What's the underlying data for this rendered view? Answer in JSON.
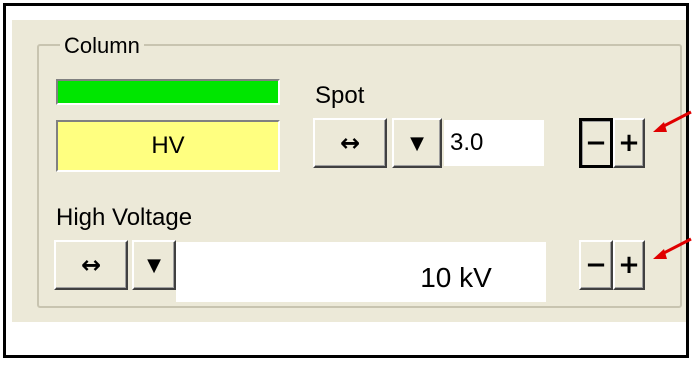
{
  "column": {
    "title": "Column",
    "hv_label": "HV",
    "spot": {
      "label": "Spot",
      "value": "3.0",
      "toggle_glyph": "↔",
      "dropdown_glyph": "▼",
      "minus": "−",
      "plus": "+"
    },
    "high_voltage": {
      "label": "High Voltage",
      "value": "10 kV",
      "toggle_glyph": "↔",
      "dropdown_glyph": "▼",
      "minus": "−",
      "plus": "+"
    }
  },
  "colors": {
    "status_bar": "#00e600",
    "hv_box": "#ffff80",
    "annotation_arrow": "#e00000"
  },
  "icons": [
    "double-arrow-icon",
    "dropdown-arrow-icon",
    "minus-icon",
    "plus-icon",
    "annotation-arrow-icon"
  ]
}
